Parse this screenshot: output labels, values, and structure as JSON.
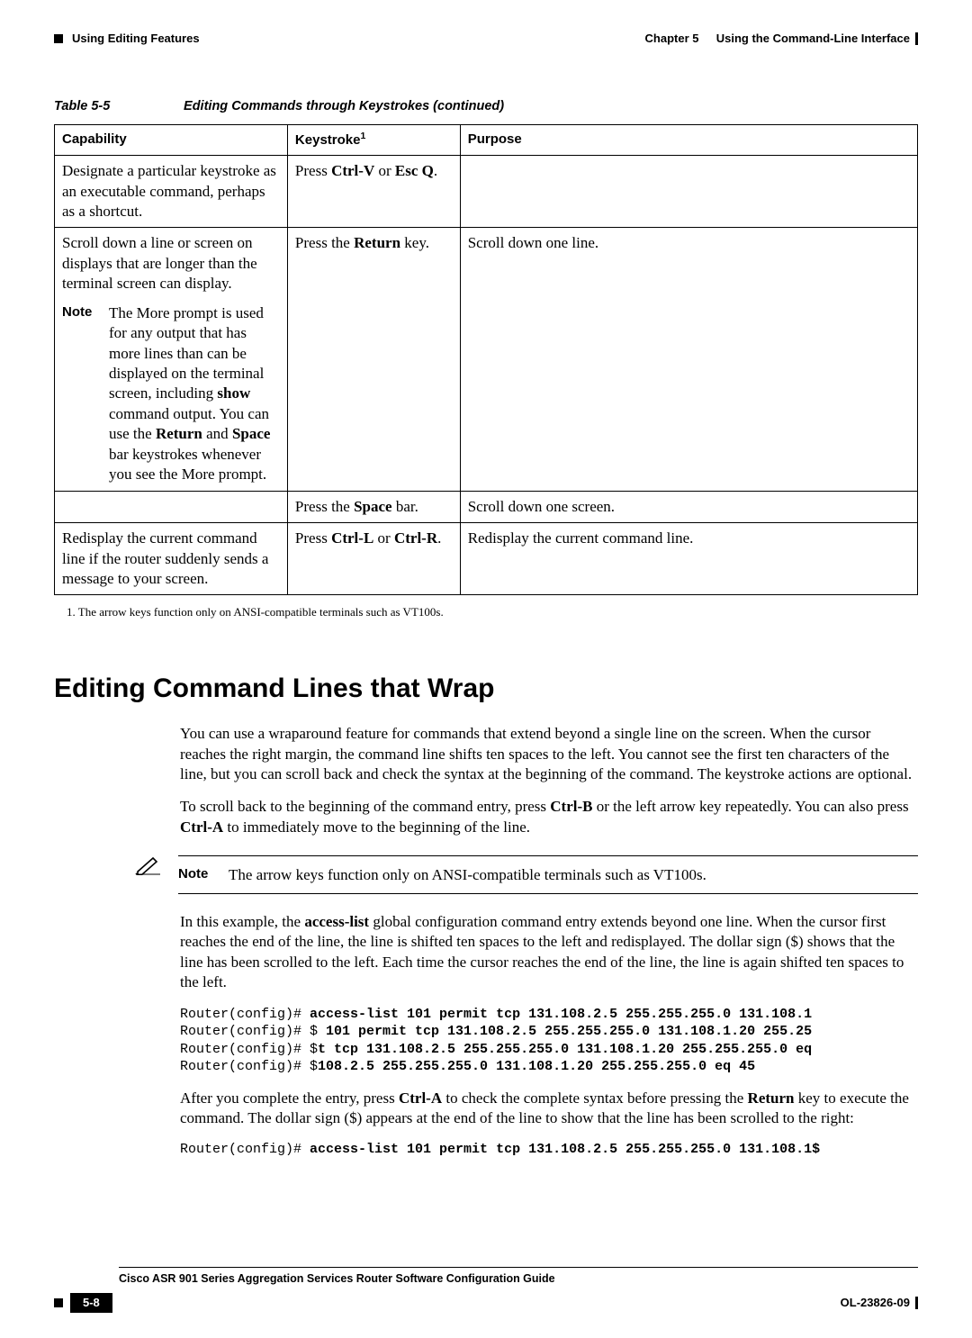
{
  "header": {
    "left_section": "Using Editing Features",
    "right_chapter": "Chapter 5",
    "right_title": "Using the Command-Line Interface"
  },
  "table_caption": {
    "label": "Table 5-5",
    "title": "Editing Commands through Keystrokes (continued)"
  },
  "table": {
    "headers": {
      "c1": "Capability",
      "c2": "Keystroke",
      "c2_sup": "1",
      "c3": "Purpose"
    },
    "rows": [
      {
        "cap": "Designate a particular keystroke as an executable command, perhaps as a shortcut.",
        "ks_pre": "Press ",
        "ks_b1": "Ctrl-V",
        "ks_mid": " or ",
        "ks_b2": "Esc Q",
        "ks_post": ".",
        "purpose": ""
      },
      {
        "cap": "Scroll down a line or screen on displays that are longer than the terminal screen can display.",
        "note_label": "Note",
        "note_pre": "The More prompt is used for any output that has more lines than can be displayed on the terminal screen, including ",
        "note_b1": "show",
        "note_mid1": " command output. You can use the ",
        "note_b2": "Return",
        "note_mid2": " and ",
        "note_b3": "Space",
        "note_post": " bar keystrokes whenever you see the More prompt.",
        "ks_pre": "Press the ",
        "ks_b1": "Return",
        "ks_post": " key.",
        "purpose": "Scroll down one line."
      },
      {
        "cap": "",
        "ks_pre": "Press the ",
        "ks_b1": "Space",
        "ks_post": " bar.",
        "purpose": "Scroll down one screen."
      },
      {
        "cap": "Redisplay the current command line if the router suddenly sends a message to your screen.",
        "ks_pre": "Press ",
        "ks_b1": "Ctrl-L",
        "ks_mid": " or ",
        "ks_b2": "Ctrl-R",
        "ks_post": ".",
        "purpose": "Redisplay the current command line."
      }
    ]
  },
  "footnote": "1.  The arrow keys function only on ANSI-compatible terminals such as VT100s.",
  "section_heading": "Editing Command Lines that Wrap",
  "para1": "You can use a wraparound feature for commands that extend beyond a single line on the screen. When the cursor reaches the right margin, the command line shifts ten spaces to the left. You cannot see the first ten characters of the line, but you can scroll back and check the syntax at the beginning of the command. The keystroke actions are optional.",
  "para2_pre": "To scroll back to the beginning of the command entry, press ",
  "para2_b1": "Ctrl-B",
  "para2_mid": " or the left arrow key repeatedly. You can also press ",
  "para2_b2": "Ctrl-A",
  "para2_post": " to immediately move to the beginning of the line.",
  "note_block": {
    "label": "Note",
    "text": "The arrow keys function only on ANSI-compatible terminals such as VT100s."
  },
  "para3_pre": "In this example, the ",
  "para3_b1": "access-list",
  "para3_post": " global configuration command entry extends beyond one line. When the cursor first reaches the end of the line, the line is shifted ten spaces to the left and redisplayed. The dollar sign ($) shows that the line has been scrolled to the left. Each time the cursor reaches the end of the line, the line is again shifted ten spaces to the left.",
  "code1": {
    "l1a": "Router(config)# ",
    "l1b": "access-list 101 permit tcp 131.108.2.5 255.255.255.0 131.108.1",
    "l2a": "Router(config)# $ ",
    "l2b": "101 permit tcp 131.108.2.5 255.255.255.0 131.108.1.20 255.25",
    "l3a": "Router(config)# $",
    "l3b": "t tcp 131.108.2.5 255.255.255.0 131.108.1.20 255.255.255.0 eq",
    "l4a": "Router(config)# $",
    "l4b": "108.2.5 255.255.255.0 131.108.1.20 255.255.255.0 eq 45"
  },
  "para4_pre": "After you complete the entry, press ",
  "para4_b1": "Ctrl-A",
  "para4_mid": " to check the complete syntax before pressing the ",
  "para4_b2": "Return",
  "para4_post": " key to execute the command. The dollar sign ($) appears at the end of the line to show that the line has been scrolled to the right:",
  "code2": {
    "l1a": "Router(config)# ",
    "l1b": "access-list 101 permit tcp 131.108.2.5 255.255.255.0 131.108.1$"
  },
  "footer": {
    "book_title": "Cisco ASR 901 Series Aggregation Services Router Software Configuration Guide",
    "page": "5-8",
    "doc_id": "OL-23826-09"
  }
}
